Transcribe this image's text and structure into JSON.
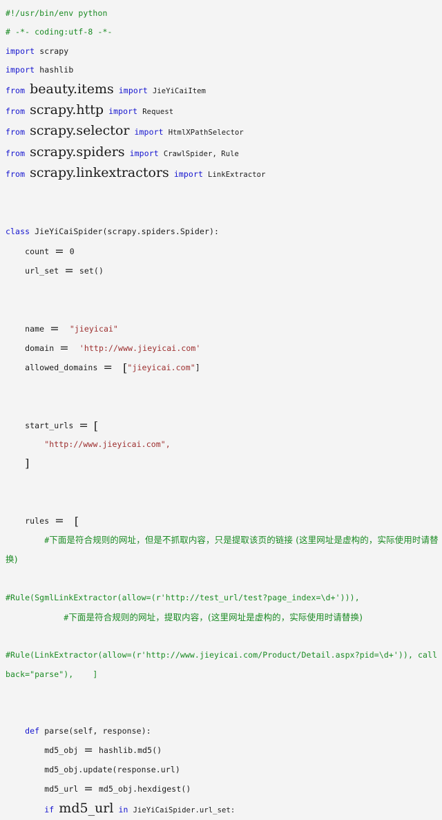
{
  "document": {
    "kind": "python-source-listing",
    "language": "Python",
    "background_color": "#f4f4f4",
    "colors": {
      "keyword": "#1414cf",
      "string": "#9c2d2d",
      "comment": "#1a8a23",
      "identifier": "#1a1a1a"
    }
  },
  "code": {
    "lines": [
      {
        "id": "l1",
        "indent": 0,
        "tokens": [
          {
            "t": "#!/usr/bin/env python",
            "c": "com"
          }
        ]
      },
      {
        "id": "l2",
        "indent": 0,
        "tokens": [
          {
            "t": "# -*- coding:utf-8 -*-",
            "c": "com"
          }
        ]
      },
      {
        "id": "l3",
        "indent": 0,
        "tokens": [
          {
            "t": "import",
            "c": "kw"
          },
          {
            "t": " ",
            "c": "plain"
          },
          {
            "t": "scrapy",
            "c": "plain"
          }
        ]
      },
      {
        "id": "l4",
        "indent": 0,
        "tokens": [
          {
            "t": "import",
            "c": "kw"
          },
          {
            "t": " ",
            "c": "plain"
          },
          {
            "t": "hashlib",
            "c": "plain"
          }
        ]
      },
      {
        "id": "l5",
        "indent": 0,
        "tokens": [
          {
            "t": "from",
            "c": "kw"
          },
          {
            "t": " ",
            "c": "plain"
          },
          {
            "t": "beauty.items",
            "c": "plain",
            "big": true
          },
          {
            "t": " ",
            "c": "plain"
          },
          {
            "t": "import",
            "c": "kw"
          },
          {
            "t": " ",
            "c": "plain"
          },
          {
            "t": "JieYiCaiItem",
            "c": "plain",
            "small": true
          }
        ]
      },
      {
        "id": "l6",
        "indent": 0,
        "tokens": [
          {
            "t": "from",
            "c": "kw"
          },
          {
            "t": " ",
            "c": "plain"
          },
          {
            "t": "scrapy.http",
            "c": "plain",
            "big": true
          },
          {
            "t": " ",
            "c": "plain"
          },
          {
            "t": "import",
            "c": "kw"
          },
          {
            "t": " ",
            "c": "plain"
          },
          {
            "t": "Request",
            "c": "plain",
            "small": true
          }
        ]
      },
      {
        "id": "l7",
        "indent": 0,
        "tokens": [
          {
            "t": "from",
            "c": "kw"
          },
          {
            "t": " ",
            "c": "plain"
          },
          {
            "t": "scrapy.selector",
            "c": "plain",
            "big": true
          },
          {
            "t": " ",
            "c": "plain"
          },
          {
            "t": "import",
            "c": "kw"
          },
          {
            "t": " ",
            "c": "plain"
          },
          {
            "t": "HtmlXPathSelector",
            "c": "plain",
            "small": true
          }
        ]
      },
      {
        "id": "l8",
        "indent": 0,
        "tokens": [
          {
            "t": "from",
            "c": "kw"
          },
          {
            "t": " ",
            "c": "plain"
          },
          {
            "t": "scrapy.spiders",
            "c": "plain",
            "big": true
          },
          {
            "t": " ",
            "c": "plain"
          },
          {
            "t": "import",
            "c": "kw"
          },
          {
            "t": " ",
            "c": "plain"
          },
          {
            "t": "CrawlSpider, Rule",
            "c": "plain",
            "small": true
          }
        ]
      },
      {
        "id": "l9",
        "indent": 0,
        "tokens": [
          {
            "t": "from",
            "c": "kw"
          },
          {
            "t": " ",
            "c": "plain"
          },
          {
            "t": "scrapy.linkextractors",
            "c": "plain",
            "big": true
          },
          {
            "t": " ",
            "c": "plain"
          },
          {
            "t": "import",
            "c": "kw"
          },
          {
            "t": " ",
            "c": "plain"
          },
          {
            "t": "LinkExtractor",
            "c": "plain",
            "small": true
          }
        ]
      },
      {
        "id": "l10",
        "indent": 0,
        "tokens": []
      },
      {
        "id": "l11",
        "indent": 0,
        "tokens": []
      },
      {
        "id": "l12",
        "indent": 0,
        "tokens": [
          {
            "t": "class",
            "c": "kw"
          },
          {
            "t": " ",
            "c": "plain"
          },
          {
            "t": "JieYiCaiSpider(scrapy.spiders.Spider):",
            "c": "plain"
          }
        ]
      },
      {
        "id": "l13",
        "indent": 1,
        "tokens": [
          {
            "t": "count ",
            "c": "plain"
          },
          {
            "t": "=",
            "c": "plain",
            "eq": true
          },
          {
            "t": " 0",
            "c": "num"
          }
        ]
      },
      {
        "id": "l14",
        "indent": 1,
        "tokens": [
          {
            "t": "url_set ",
            "c": "plain"
          },
          {
            "t": "=",
            "c": "plain",
            "eq": true
          },
          {
            "t": " set()",
            "c": "plain"
          }
        ]
      },
      {
        "id": "l15",
        "indent": 0,
        "tokens": []
      },
      {
        "id": "l16",
        "indent": 0,
        "tokens": []
      },
      {
        "id": "l17",
        "indent": 1,
        "tokens": [
          {
            "t": "name ",
            "c": "plain"
          },
          {
            "t": "=",
            "c": "plain",
            "eq": true
          },
          {
            "t": "  ",
            "c": "plain"
          },
          {
            "t": "\"jieyicai\"",
            "c": "str"
          }
        ]
      },
      {
        "id": "l18",
        "indent": 1,
        "tokens": [
          {
            "t": "domain ",
            "c": "plain"
          },
          {
            "t": "=",
            "c": "plain",
            "eq": true
          },
          {
            "t": "  ",
            "c": "plain"
          },
          {
            "t": "'http://www.jieyicai.com'",
            "c": "str"
          }
        ]
      },
      {
        "id": "l19",
        "indent": 1,
        "tokens": [
          {
            "t": "allowed_domains ",
            "c": "plain"
          },
          {
            "t": "=",
            "c": "plain",
            "eq": true
          },
          {
            "t": "  ",
            "c": "plain"
          },
          {
            "t": "[",
            "c": "plain",
            "brk": true
          },
          {
            "t": "\"jieyicai.com\"",
            "c": "str"
          },
          {
            "t": "]",
            "c": "plain"
          }
        ]
      },
      {
        "id": "l20",
        "indent": 0,
        "tokens": []
      },
      {
        "id": "l21",
        "indent": 0,
        "tokens": []
      },
      {
        "id": "l22",
        "indent": 1,
        "tokens": [
          {
            "t": "start_urls ",
            "c": "plain"
          },
          {
            "t": "=",
            "c": "plain",
            "eq": true
          },
          {
            "t": " ",
            "c": "plain"
          },
          {
            "t": "[",
            "c": "plain",
            "brk": true
          }
        ]
      },
      {
        "id": "l23",
        "indent": 2,
        "tokens": [
          {
            "t": "\"http://www.jieyicai.com\",",
            "c": "str"
          }
        ]
      },
      {
        "id": "l24",
        "indent": 1,
        "tokens": [
          {
            "t": "]",
            "c": "plain",
            "brk": true
          }
        ]
      },
      {
        "id": "l25",
        "indent": 0,
        "tokens": []
      },
      {
        "id": "l26",
        "indent": 0,
        "tokens": []
      },
      {
        "id": "l27",
        "indent": 1,
        "tokens": [
          {
            "t": "rules ",
            "c": "plain"
          },
          {
            "t": "=",
            "c": "plain",
            "eq": true
          },
          {
            "t": "  ",
            "c": "plain"
          },
          {
            "t": "[",
            "c": "plain",
            "brk": true
          }
        ]
      },
      {
        "id": "l28",
        "indent": 2,
        "tokens": [
          {
            "t": "#",
            "c": "com"
          },
          {
            "t": "下面是符合规则的网址，但是不抓取内容，只是提取该页的链接 (这里网址是虚构的，实际使用时请替换)",
            "c": "com",
            "cjk": true
          }
        ]
      },
      {
        "id": "l29",
        "indent": 0,
        "tokens": []
      },
      {
        "id": "l30",
        "indent": 0,
        "tokens": [
          {
            "t": "#Rule(SgmlLinkExtractor(allow=(r'http://test_url/test?page_index=\\d+'))),",
            "c": "com"
          }
        ]
      },
      {
        "id": "l31",
        "indent": 3,
        "tokens": [
          {
            "t": "#",
            "c": "com"
          },
          {
            "t": "下面是符合规则的网址，提取内容，(这里网址是虚构的，实际使用时请替换)",
            "c": "com",
            "cjk": true
          }
        ]
      },
      {
        "id": "l32",
        "indent": 0,
        "tokens": []
      },
      {
        "id": "l33",
        "indent": 0,
        "tokens": [
          {
            "t": "#Rule(LinkExtractor(allow=(r'http://www.jieyicai.com/Product/Detail.aspx?pid=\\d+')), callback=\"parse\"),    ]",
            "c": "com"
          }
        ]
      },
      {
        "id": "l34",
        "indent": 0,
        "tokens": []
      },
      {
        "id": "l35",
        "indent": 0,
        "tokens": []
      },
      {
        "id": "l36",
        "indent": 1,
        "tokens": [
          {
            "t": "def",
            "c": "kw"
          },
          {
            "t": " ",
            "c": "plain"
          },
          {
            "t": "parse(self, response):",
            "c": "plain"
          }
        ]
      },
      {
        "id": "l37",
        "indent": 2,
        "tokens": [
          {
            "t": "md5_obj ",
            "c": "plain"
          },
          {
            "t": "=",
            "c": "plain",
            "eq": true
          },
          {
            "t": " hashlib.md5()",
            "c": "plain"
          }
        ]
      },
      {
        "id": "l38",
        "indent": 2,
        "tokens": [
          {
            "t": "md5_obj.update(response.url)",
            "c": "plain"
          }
        ]
      },
      {
        "id": "l39",
        "indent": 2,
        "tokens": [
          {
            "t": "md5_url ",
            "c": "plain"
          },
          {
            "t": "=",
            "c": "plain",
            "eq": true
          },
          {
            "t": " md5_obj.hexdigest()",
            "c": "plain"
          }
        ]
      },
      {
        "id": "l40",
        "indent": 2,
        "tokens": [
          {
            "t": "if",
            "c": "kw"
          },
          {
            "t": " ",
            "c": "plain"
          },
          {
            "t": "md5_url",
            "c": "plain",
            "big": true
          },
          {
            "t": " ",
            "c": "plain"
          },
          {
            "t": "in",
            "c": "kw"
          },
          {
            "t": " ",
            "c": "plain"
          },
          {
            "t": "JieYiCaiSpider.url_set:",
            "c": "plain",
            "small": true
          }
        ]
      }
    ]
  }
}
